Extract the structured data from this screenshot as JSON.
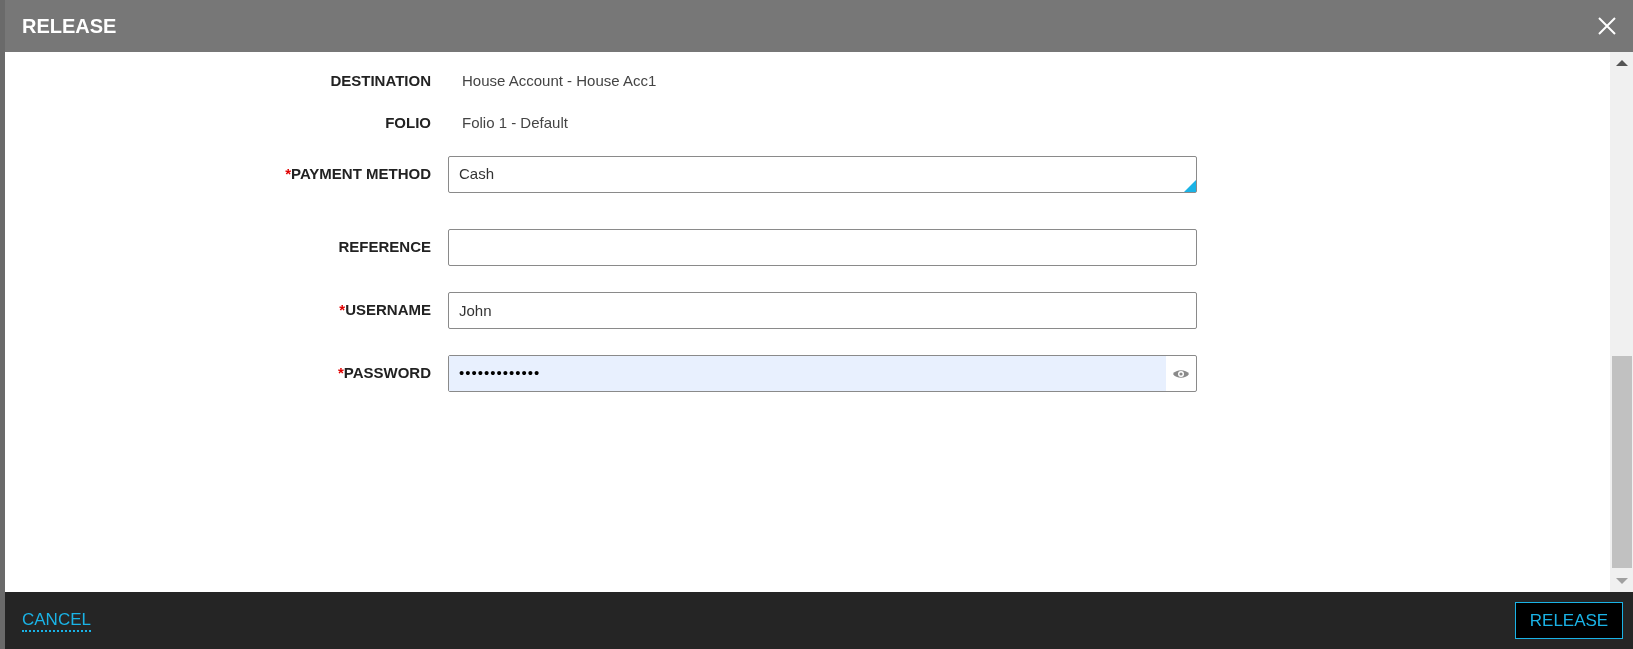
{
  "dialog": {
    "title": "RELEASE"
  },
  "fields": [
    {
      "kind": "text",
      "label": "DESTINATION",
      "value": "House Account - House Acc1"
    },
    {
      "kind": "text",
      "label": "FOLIO",
      "value": "Folio 1 - Default"
    },
    {
      "kind": "select",
      "required_mark": "*",
      "label": "PAYMENT METHOD",
      "value": "Cash"
    },
    {
      "kind": "input",
      "label": "REFERENCE"
    },
    {
      "kind": "input",
      "required_mark": "*",
      "label": "USERNAME",
      "value": "John"
    },
    {
      "kind": "password",
      "required_mark": "*",
      "label": "PASSWORD",
      "value": "•••••••••••••"
    }
  ],
  "footer": {
    "cancel": "CANCEL",
    "confirm": "RELEASE"
  }
}
